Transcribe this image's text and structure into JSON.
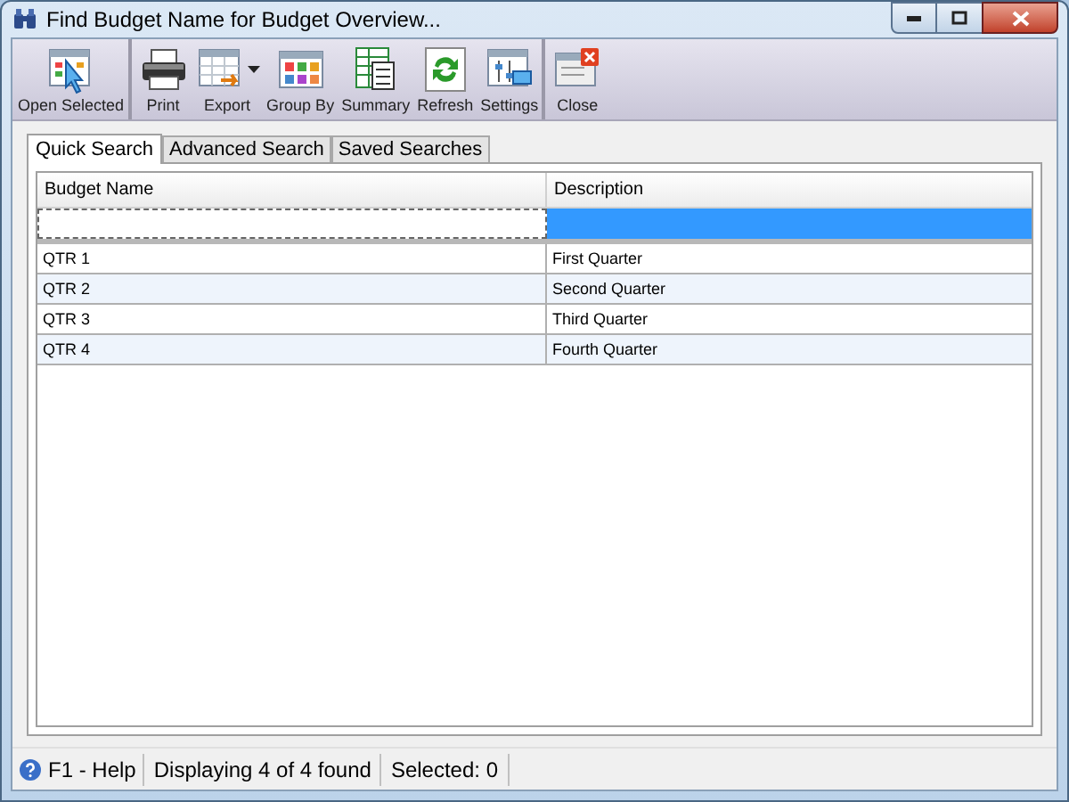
{
  "window": {
    "title": "Find Budget Name for Budget Overview..."
  },
  "toolbar": [
    {
      "label": "Open Selected",
      "separator_after": true,
      "has_dropdown": false
    },
    {
      "label": "Print",
      "separator_after": false,
      "has_dropdown": false
    },
    {
      "label": "Export",
      "separator_after": false,
      "has_dropdown": true
    },
    {
      "label": "Group By",
      "separator_after": false,
      "has_dropdown": false
    },
    {
      "label": "Summary",
      "separator_after": false,
      "has_dropdown": false
    },
    {
      "label": "Refresh",
      "separator_after": false,
      "has_dropdown": false
    },
    {
      "label": "Settings",
      "separator_after": true,
      "has_dropdown": false
    },
    {
      "label": "Close",
      "separator_after": false,
      "has_dropdown": false
    }
  ],
  "tabs": [
    {
      "label": "Quick Search",
      "selected": true
    },
    {
      "label": "Advanced Search",
      "selected": false
    },
    {
      "label": "Saved Searches",
      "selected": false
    }
  ],
  "table": {
    "columns": [
      "Budget Name",
      "Description"
    ],
    "filter_cells": [
      {
        "selected": false
      },
      {
        "selected": true
      }
    ],
    "rows": [
      [
        "QTR 1",
        "First Quarter"
      ],
      [
        "QTR 2",
        "Second Quarter"
      ],
      [
        "QTR 3",
        "Third Quarter"
      ],
      [
        "QTR 4",
        "Fourth Quarter"
      ]
    ]
  },
  "status_bar": {
    "help": "F1 - Help",
    "count": "Displaying 4 of 4 found",
    "selected": "Selected: 0"
  }
}
